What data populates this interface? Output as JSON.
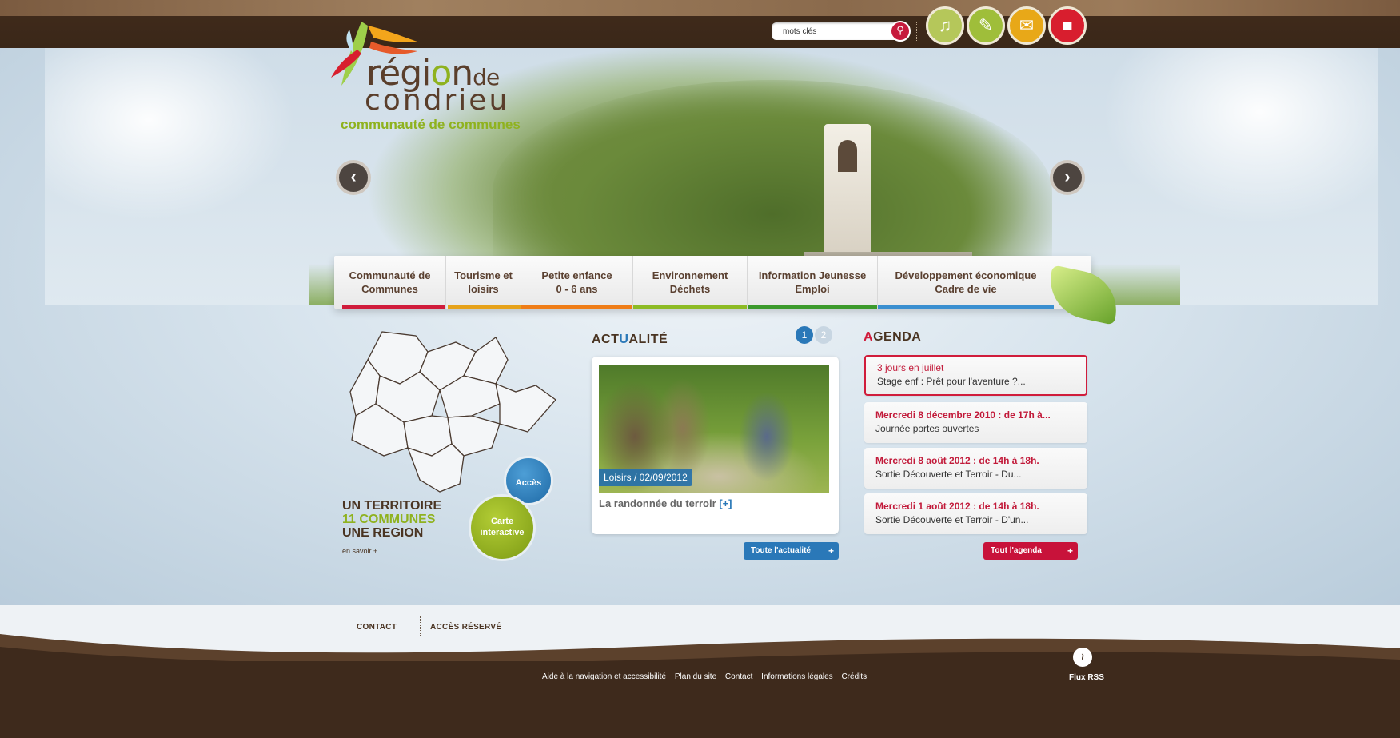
{
  "header": {
    "search": {
      "placeholder": "mots clés",
      "value": "mots clés"
    },
    "icons": [
      {
        "name": "piano-icon",
        "color": "#b5c75a"
      },
      {
        "name": "edit-icon",
        "color": "#9fbe3a"
      },
      {
        "name": "mail-icon",
        "color": "#e8a818"
      },
      {
        "name": "book-icon",
        "color": "#d81e2e"
      }
    ]
  },
  "logo": {
    "line1_pre": "régi",
    "line1_o": "o",
    "line1_post": "n",
    "line1_de": "de",
    "line2": "condrieu",
    "line3": "communauté de communes"
  },
  "slider": {
    "prev": "‹",
    "next": "›"
  },
  "nav": {
    "items": [
      {
        "label1": "Communauté de",
        "label2": "Communes",
        "color": "#d01c3b"
      },
      {
        "label1": "Tourisme et",
        "label2": "loisirs",
        "color": "#e6a21a"
      },
      {
        "label1": "Petite enfance",
        "label2": "0 - 6 ans",
        "color": "#ef7d17"
      },
      {
        "label1": "Environnement",
        "label2": "Déchets",
        "color": "#8dbb25"
      },
      {
        "label1": "Information Jeunesse",
        "label2": "Emploi",
        "color": "#3c9a2c"
      },
      {
        "label1": "Développement économique",
        "label2": "Cadre de vie",
        "color": "#3a8fd0"
      }
    ]
  },
  "territory": {
    "line1": "UN TERRITOIRE",
    "line2": "11 COMMUNES",
    "line3": "UNE REGION",
    "more": "en savoir +",
    "acces": "Accès",
    "carte1": "Carte",
    "carte2": "interactive"
  },
  "actualite": {
    "title_a": "ACT",
    "title_u": "U",
    "title_b": "ALITÉ",
    "pages": [
      "1",
      "2"
    ],
    "tag": "Loisirs / 02/09/2012",
    "caption": "La randonnée du terroir",
    "caption_plus": "[+]",
    "all": "Toute l'actualité",
    "plus": "+"
  },
  "agenda": {
    "title_a": "A",
    "title_b": "GENDA",
    "items": [
      {
        "date": "3 jours en juillet",
        "text": "Stage enf : Prêt pour l'aventure ?..."
      },
      {
        "date": "Mercredi 8 décembre 2010 : de 17h à...",
        "text": "Journée portes ouvertes"
      },
      {
        "date": "Mercredi 8 août 2012 : de 14h à 18h.",
        "text": "Sortie Découverte et Terroir - Du..."
      },
      {
        "date": "Mercredi 1 août 2012 : de 14h à 18h.",
        "text": "Sortie Découverte et Terroir - D'un..."
      }
    ],
    "all": "Tout l'agenda",
    "plus": "+"
  },
  "footer": {
    "contact": "CONTACT",
    "reserved": "ACCÈS RÉSERVÉ",
    "links": [
      "Aide à la navigation et accessibilité",
      "Plan du site",
      "Contact",
      "Informations légales",
      "Crédits"
    ],
    "rss": "Flux RSS"
  },
  "colors": {
    "brown": "#3e2a1c",
    "green": "#8fb21f",
    "blue": "#2a78b8",
    "red": "#d01c3b"
  }
}
